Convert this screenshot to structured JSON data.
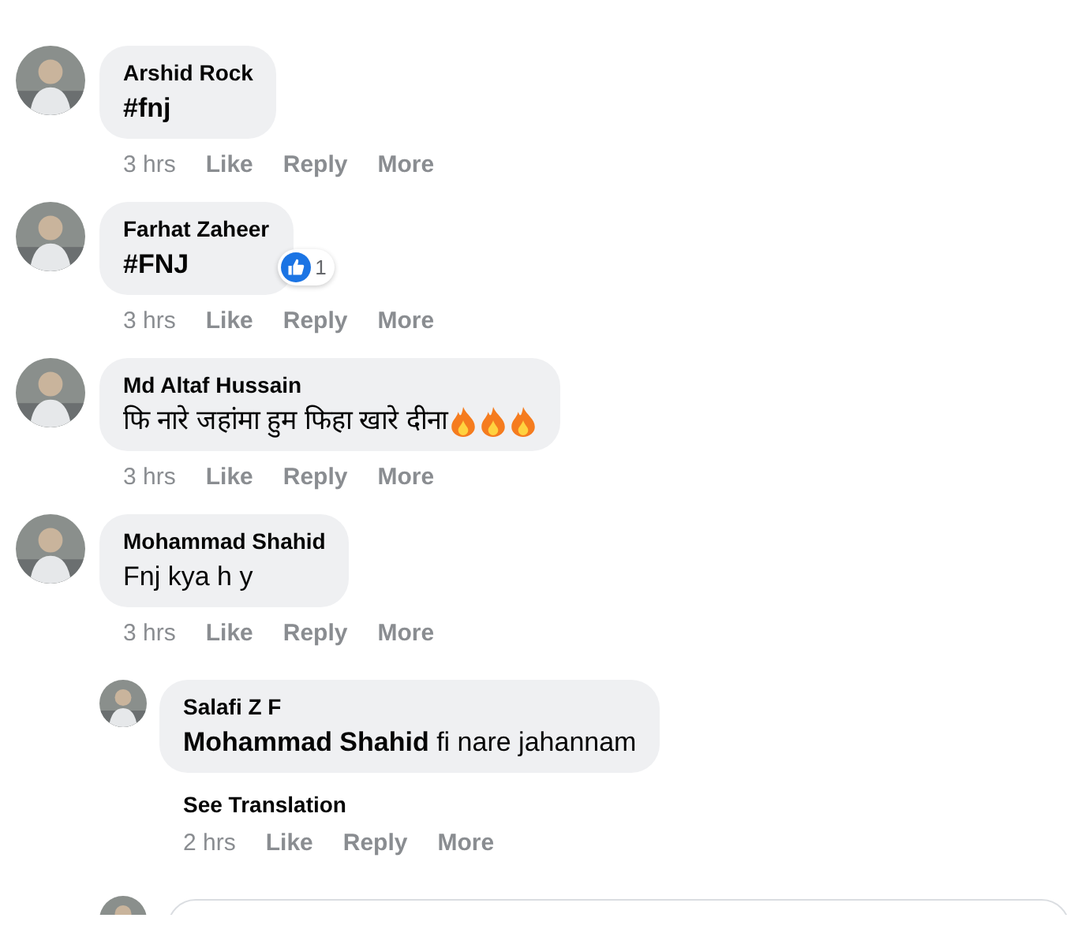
{
  "comments": [
    {
      "author": "Arshid Rock",
      "text": "#fnj",
      "bold": true,
      "time": "3 hrs",
      "actions": [
        "Like",
        "Reply",
        "More"
      ]
    },
    {
      "author": "Farhat Zaheer",
      "text": "#FNJ",
      "bold": true,
      "time": "3 hrs",
      "actions": [
        "Like",
        "Reply",
        "More"
      ],
      "reaction_count": "1"
    },
    {
      "author": "Md Altaf Hussain",
      "text": "फि नारे जहांमा हुम फिहा खारे दीना",
      "emojis": [
        {
          "kind": "fire"
        },
        {
          "kind": "fire"
        },
        {
          "kind": "fire"
        }
      ],
      "time": "3 hrs",
      "actions": [
        "Like",
        "Reply",
        "More"
      ]
    },
    {
      "author": "Mohammad Shahid",
      "text": "Fnj kya h y",
      "time": "3 hrs",
      "actions": [
        "Like",
        "Reply",
        "More"
      ],
      "replies": [
        {
          "author": "Salafi Z F",
          "text": "**Mohammad Shahid** fi nare jahannam",
          "translation": "See Translation",
          "time": "2 hrs",
          "actions": [
            "Like",
            "Reply",
            "More"
          ]
        }
      ]
    }
  ],
  "reply_box": {
    "kind": "field"
  }
}
